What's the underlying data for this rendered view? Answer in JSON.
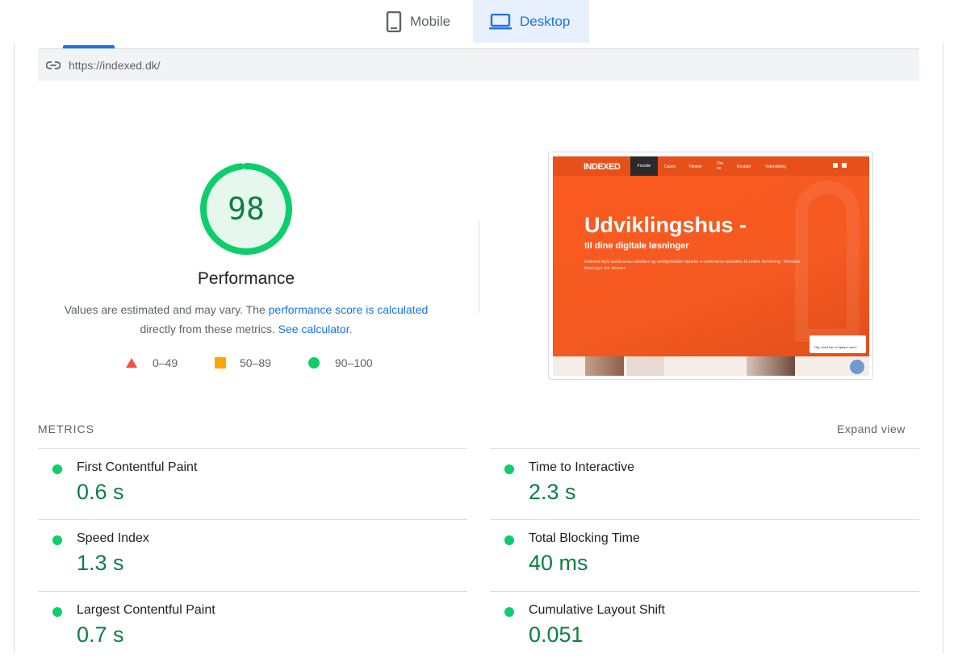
{
  "tabs": {
    "mobile": "Mobile",
    "desktop": "Desktop",
    "active": "Desktop"
  },
  "url": "https://indexed.dk/",
  "performance": {
    "score": "98",
    "title": "Performance",
    "desc_pre": "Values are estimated and may vary. The ",
    "desc_link": "performance score is calculated",
    "desc_mid": "directly from these metrics. ",
    "desc_link2": "See calculator",
    "desc_end": "."
  },
  "legend": [
    {
      "label": "0–49",
      "icon": "triangle",
      "color": "#ff4e42"
    },
    {
      "label": "50–89",
      "icon": "square",
      "color": "#ffa400"
    },
    {
      "label": "90–100",
      "icon": "circle",
      "color": "#0cce6b"
    }
  ],
  "thumbnail": {
    "logo": "INDEXED",
    "nav": [
      "Forside",
      "Cases",
      "Ydelser",
      "Om os",
      "Kontakt",
      "Videndeling"
    ],
    "headline": "Udviklingshus -",
    "subheadline": "til dine digitale løsninger",
    "body": "Indexed ApS webbureau udvikler og vedligeholder danske e-commerce websites til online forretning. Tekniske løsninger der leverer.",
    "chat": "Hej, hvad kan vi hjælpe med?"
  },
  "metrics": {
    "heading": "METRICS",
    "expand": "Expand view",
    "items": [
      {
        "name": "First Contentful Paint",
        "value": "0.6 s"
      },
      {
        "name": "Time to Interactive",
        "value": "2.3 s"
      },
      {
        "name": "Speed Index",
        "value": "1.3 s"
      },
      {
        "name": "Total Blocking Time",
        "value": "40 ms"
      },
      {
        "name": "Largest Contentful Paint",
        "value": "0.7 s"
      },
      {
        "name": "Cumulative Layout Shift",
        "value": "0.051"
      }
    ]
  },
  "colors": {
    "accent": "#1a73e8",
    "pass": "#0cce6b",
    "pass_text": "#0b8043",
    "brand_orange": "#fb5a1e"
  }
}
